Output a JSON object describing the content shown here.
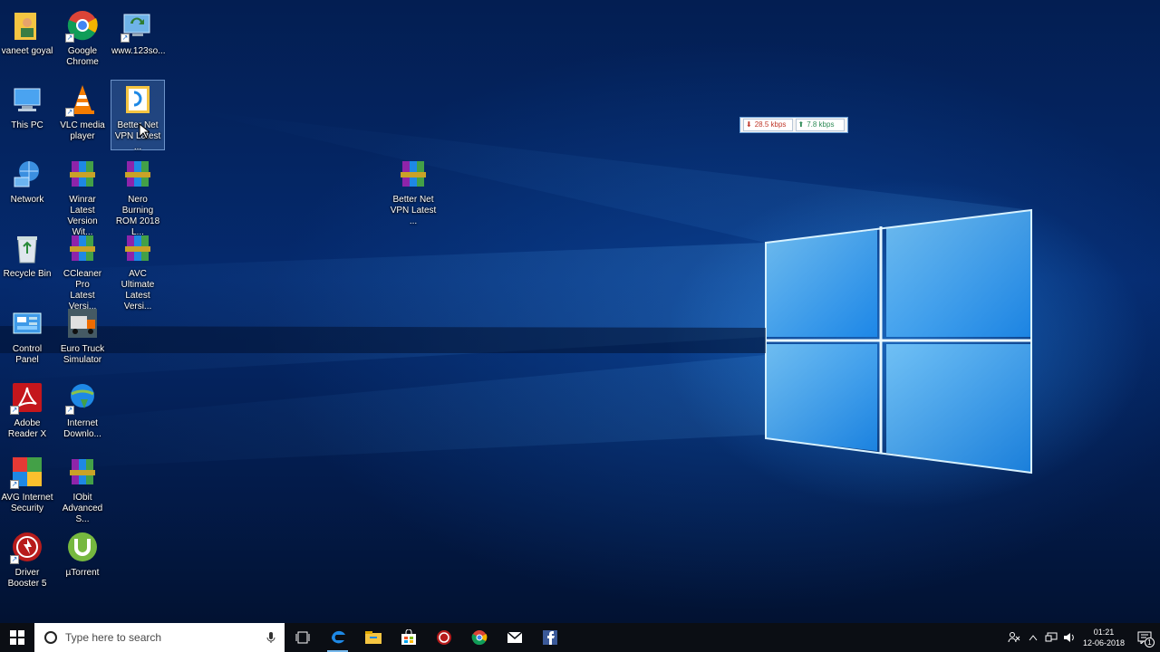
{
  "desktop_icons": {
    "vaneet_goyal": "vaneet goyal",
    "google_chrome": "Google\nChrome",
    "www123so": "www.123so...",
    "this_pc": "This PC",
    "vlc": "VLC media\nplayer",
    "betternet_selected": "Better Net\nVPN Latest ...",
    "network": "Network",
    "winrar": "Winrar Latest\nVersion Wit...",
    "nero": "Nero Burning\nROM 2018 L...",
    "betternet_rar": "Better Net\nVPN Latest ...",
    "recycle_bin": "Recycle Bin",
    "ccleaner": "CCleaner Pro\nLatest Versi...",
    "avc": "AVC Ultimate\nLatest Versi...",
    "control_panel": "Control Panel",
    "euro_truck": "Euro Truck\nSimulator",
    "adobe": "Adobe\nReader X",
    "idm": "Internet\nDownlo...",
    "avg": "AVG Internet\nSecurity",
    "iobit": "IObit\nAdvanced S...",
    "driver_booster": "Driver\nBooster 5",
    "utorrent": "µTorrent"
  },
  "net_speed": {
    "download": "28.5 kbps",
    "upload": "7.8 kbps"
  },
  "taskbar": {
    "search_placeholder": "Type here to search",
    "time": "01:21",
    "date": "12-06-2018",
    "notification_count": "1"
  }
}
